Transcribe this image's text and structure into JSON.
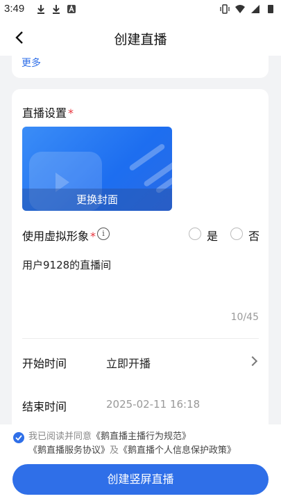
{
  "status_bar": {
    "time": "3:49"
  },
  "nav": {
    "title": "创建直播"
  },
  "top_card": {
    "more_label": "更多"
  },
  "settings": {
    "section_title": "直播设置",
    "required_mark": "*",
    "cover_button": "更换封面",
    "avatar_label": "使用虚拟形象",
    "info_glyph": "i",
    "option_yes": "是",
    "option_no": "否",
    "title_value": "用户9128的直播间",
    "title_counter": "10/45",
    "start_label": "开始时间",
    "start_value": "立即开播",
    "end_label": "结束时间",
    "end_value": "2025-02-11 16:18"
  },
  "agreement": {
    "prefix": "我已阅读并同意",
    "link1": "《鹅直播主播行为规范》",
    "link2": "《鹅直播服务协议》",
    "joiner": "及",
    "link3": "《鹅直播个人信息保护政策》"
  },
  "primary_button": "创建竖屏直播",
  "colors": {
    "accent": "#2f6fe8",
    "required": "#e8343c"
  }
}
